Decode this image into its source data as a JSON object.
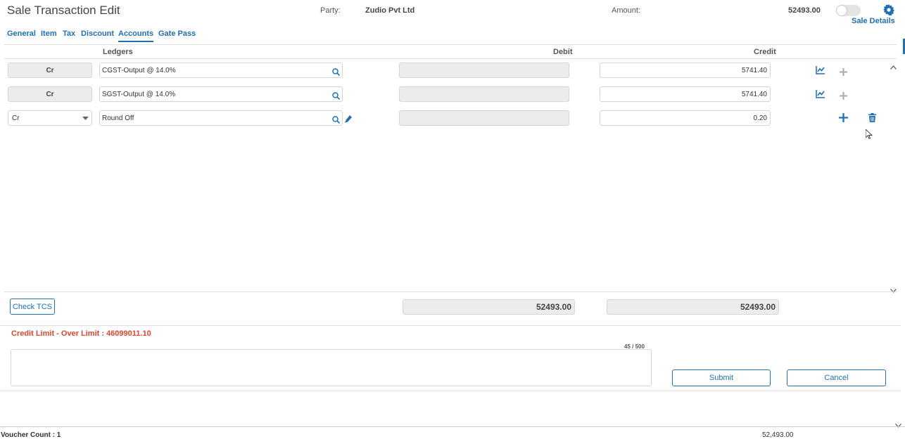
{
  "header": {
    "title": "Sale Transaction Edit",
    "party_label": "Party:",
    "party_value": "Zudio Pvt Ltd",
    "amount_label": "Amount:",
    "amount_value": "52493.00",
    "sale_details_link": "Sale Details"
  },
  "tabs": [
    {
      "label": "General",
      "active": false
    },
    {
      "label": "Item",
      "active": false
    },
    {
      "label": "Tax",
      "active": false
    },
    {
      "label": "Discount",
      "active": false
    },
    {
      "label": "Accounts",
      "active": true
    },
    {
      "label": "Gate Pass",
      "active": false
    }
  ],
  "columns": {
    "ledgers": "Ledgers",
    "debit": "Debit",
    "credit": "Credit"
  },
  "rows": [
    {
      "type": "Cr",
      "ledger": "CGST-Output @ 14.0%",
      "debit": "",
      "credit": "5741.40"
    },
    {
      "type": "Cr",
      "ledger": "SGST-Output @ 14.0%",
      "debit": "",
      "credit": "5741.40"
    },
    {
      "type": "Cr",
      "ledger": "Round Off",
      "debit": "",
      "credit": "0.20"
    }
  ],
  "footer": {
    "check_tcs_label": "Check TCS",
    "debit_total": "52493.00",
    "credit_total": "52493.00",
    "credit_limit_text": "Credit Limit - Over Limit : 46099011.10",
    "char_counter": "45 / 500",
    "remarks_value": "",
    "submit_label": "Submit",
    "cancel_label": "Cancel"
  },
  "status_bar": {
    "voucher_count": "Voucher Count : 1",
    "total": "52,493.00"
  },
  "colors": {
    "accent": "#1f6fb5",
    "warning": "#d9452f",
    "field_grey": "#ececec"
  }
}
